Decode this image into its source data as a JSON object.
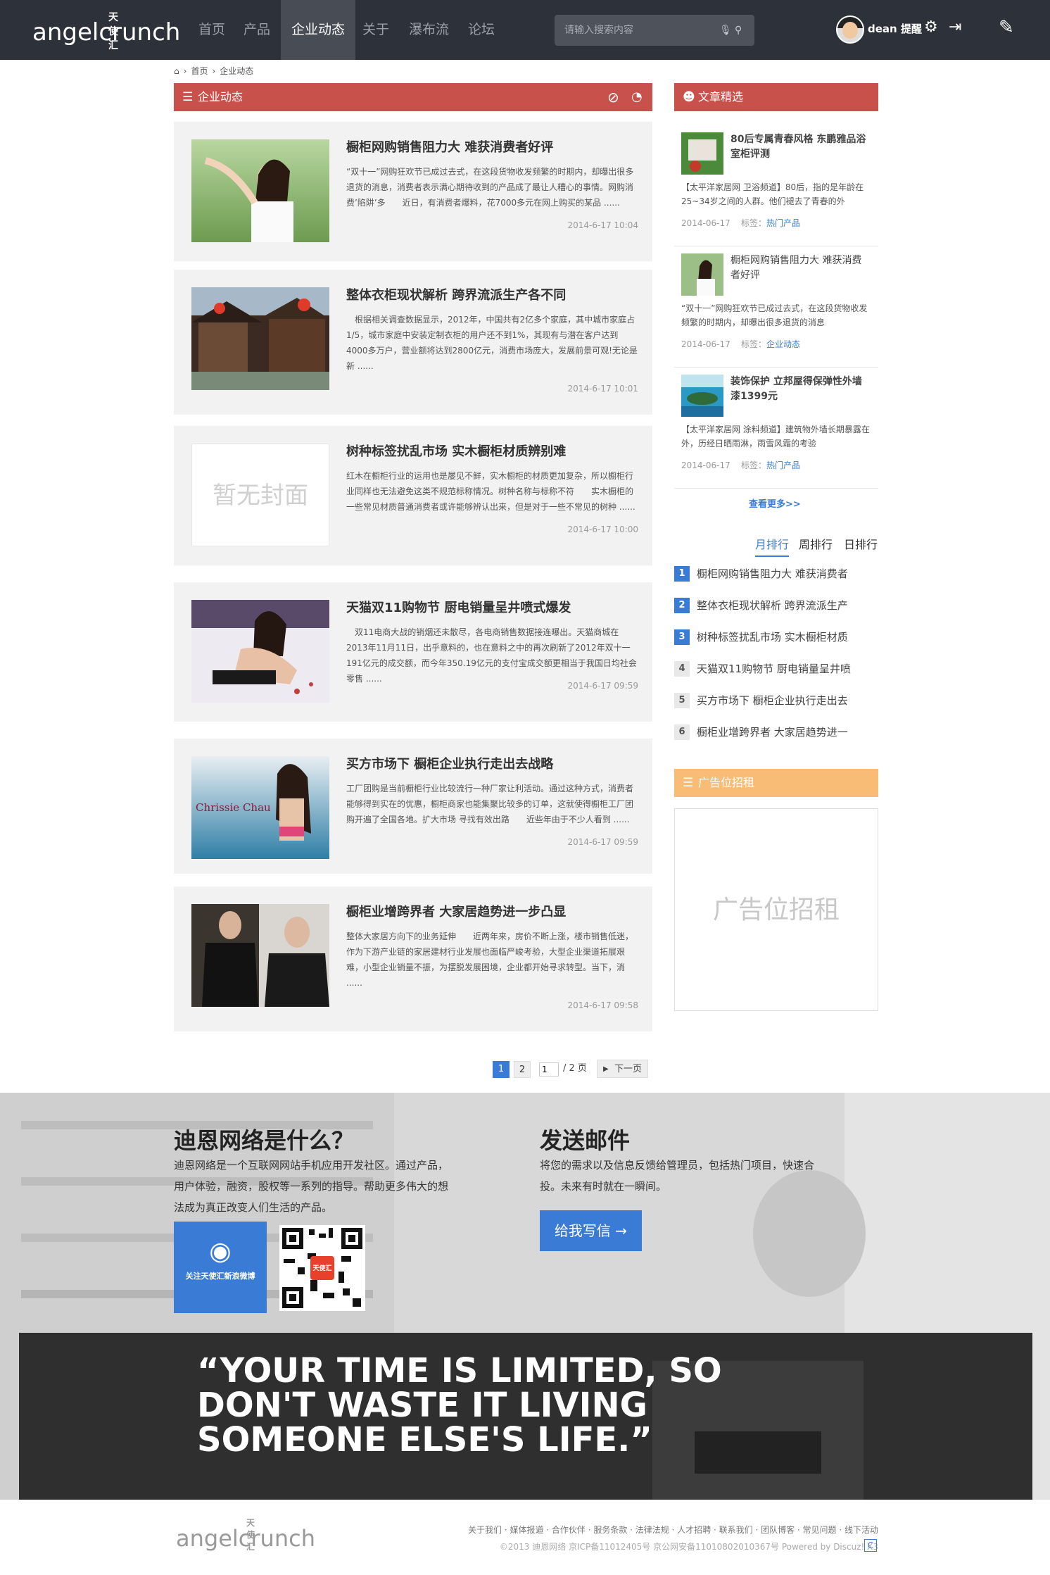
{
  "header": {
    "logo_sub": "天使汇",
    "logo_main": "angelcrunch",
    "nav": [
      "首页",
      "产品",
      "企业动态",
      "关于",
      "瀑布流",
      "论坛"
    ],
    "active_nav": "企业动态",
    "search_placeholder": "请输入搜索内容",
    "user_name": "dean",
    "user_notice": "提醒"
  },
  "breadcrumb": {
    "home": "首页",
    "current": "企业动态"
  },
  "main_section": {
    "title": "企业动态"
  },
  "articles": [
    {
      "title": "橱柜网购销售阻力大 难获消费者好评",
      "excerpt": "“双十一”网购狂欢节已成过去式，在这段货物收发频繁的时期内，却曝出很多退货的消息，消费者表示满心期待收到的产品成了最让人糟心的事情。网购消费’陷阱’多　　近日，有消费者爆料，花7000多元在网上购买的某品 ......",
      "date": "2014-6-17 10:04"
    },
    {
      "title": "整体衣柜现状解析 跨界流派生产各不同",
      "excerpt": "　根据相关调查数据显示，2012年，中国共有2亿多个家庭，其中城市家庭占1/5，城市家庭中安装定制衣柜的用户还不到1%，其现有与潜在客户达到4000多万户，营业额将达到2800亿元，消费市场庞大，发展前景可观!无论是新 ......",
      "date": "2014-6-17 10:01"
    },
    {
      "title": "树种标签扰乱市场 实木橱柜材质辨别难",
      "excerpt": "红木在橱柜行业的运用也是屡见不鲜，实木橱柜的材质更加复杂，所以橱柜行业同样也无法避免这类不规范标称情况。树种名称与标称不符　　实木橱柜的一些常见材质普通消费者或许能够辨认出来，但是对于一些不常见的树种 ......",
      "date": "2014-6-17 10:00",
      "cover": "暂无封面"
    },
    {
      "title": "天猫双11购物节 厨电销量呈井喷式爆发",
      "excerpt": "　双11电商大战的销烟还未散尽，各电商销售数据接连曝出。天猫商城在2013年11月11日，出乎意料的，也在意料之中的再次刷新了2012年双十一191亿元的成交额，而今年350.19亿元的支付宝成交额更相当于我国日均社会零售 ......",
      "date": "2014-6-17 09:59"
    },
    {
      "title": "买方市场下 橱柜企业执行走出去战略",
      "excerpt": "工厂团购是当前橱柜行业比较流行一种厂家让利活动。通过这种方式，消费者能够得到实在的优惠，橱柜商家也能集聚比较多的订单，这就使得橱柜工厂团购开遍了全国各地。扩大市场 寻找有效出路　　近些年由于不少人看到 ......",
      "date": "2014-6-17 09:59",
      "thumb_text": "Chrissie Chau"
    },
    {
      "title": "橱柜业增跨界者 大家居趋势进一步凸显",
      "excerpt": "整体大家居方向下的业务延伸　　近两年来，房价不断上涨，楼市销售低迷，作为下游产业链的家居建材行业发展也面临严峻考验，大型企业渠道拓展艰难，小型企业销量不振，为摆脱发展困境，企业都开始寻求转型。当下，消 ......",
      "date": "2014-6-17 09:58"
    }
  ],
  "pagination": {
    "pages": [
      "1",
      "2"
    ],
    "current": "1",
    "input_value": "1",
    "total": "/ 2 页",
    "next": "下一页"
  },
  "sidebar": {
    "featured_title": "文章精选",
    "featured": [
      {
        "title": "80后专属青春风格 东鹏雅品浴室柜评测",
        "excerpt": "【太平洋家居网 卫浴频道】80后，指的是年龄在25~34岁之间的人群。他们褪去了青春的外",
        "date": "2014-06-17",
        "tag_label": "标签：",
        "tag": "热门产品"
      },
      {
        "title": "橱柜网购销售阻力大 难获消费者好评",
        "excerpt": "“双十一”网购狂欢节已成过去式，在这段货物收发频繁的时期内，却曝出很多退货的消息",
        "date": "2014-06-17",
        "tag_label": "标签：",
        "tag": "企业动态"
      },
      {
        "title": "装饰保护 立邦屋得保弹性外墙漆1399元",
        "excerpt": "【太平洋家居网 涂料频道】建筑物外墙长期暴露在外，历经日晒雨淋，雨雪风霜的考验",
        "date": "2014-06-17",
        "tag_label": "标签：",
        "tag": "热门产品"
      }
    ],
    "more": "查看更多>>",
    "rank_tabs": [
      "月排行",
      "周排行",
      "日排行"
    ],
    "rank_active": "月排行",
    "ranking": [
      {
        "n": "1",
        "title": "橱柜网购销售阻力大 难获消费者"
      },
      {
        "n": "2",
        "title": "整体衣柜现状解析 跨界流派生产"
      },
      {
        "n": "3",
        "title": "树种标签扰乱市场 实木橱柜材质"
      },
      {
        "n": "4",
        "title": "天猫双11购物节 厨电销量呈井喷"
      },
      {
        "n": "5",
        "title": "买方市场下 橱柜企业执行走出去"
      },
      {
        "n": "6",
        "title": "橱柜业增跨界者 大家居趋势进一"
      }
    ],
    "ad_title": "广告位招租",
    "ad_text": "广告位招租"
  },
  "footer": {
    "about_title": "迪恩网络是什么？",
    "about_lines": [
      "迪恩网络是一个互联网网站手机应用开发社区。通过产品，",
      "用户体验，融资，股权等一系列的指导。帮助更多伟大的想",
      "法成为真正改变人们生活的产品。"
    ],
    "weibo_label": "关注天使汇新浪微博",
    "qr_badge": "天使汇",
    "mail_title": "发送邮件",
    "mail_lines": [
      "将您的需求以及信息反馈给管理员，包括热门项目，快速合",
      "投。未来有时就在一瞬间。"
    ],
    "mail_button": "给我写信 →",
    "quote": "“YOUR TIME IS LIMITED, SO DON'T WASTE IT LIVING SOMEONE ELSE'S LIFE.”",
    "links": "关于我们 · 媒体报道 · 合作伙伴 · 服务条款 · 法律法规 · 人才招聘 · 联系我们 · 团队博客 · 常见问题 · 线下活动",
    "copyright": "©2013 迪恩网络   京ICP备11012405号   京公网安备11010802010367号   Powered by Discuz! X3",
    "logo_sub": "天使汇",
    "logo_main": "angelcrunch"
  }
}
